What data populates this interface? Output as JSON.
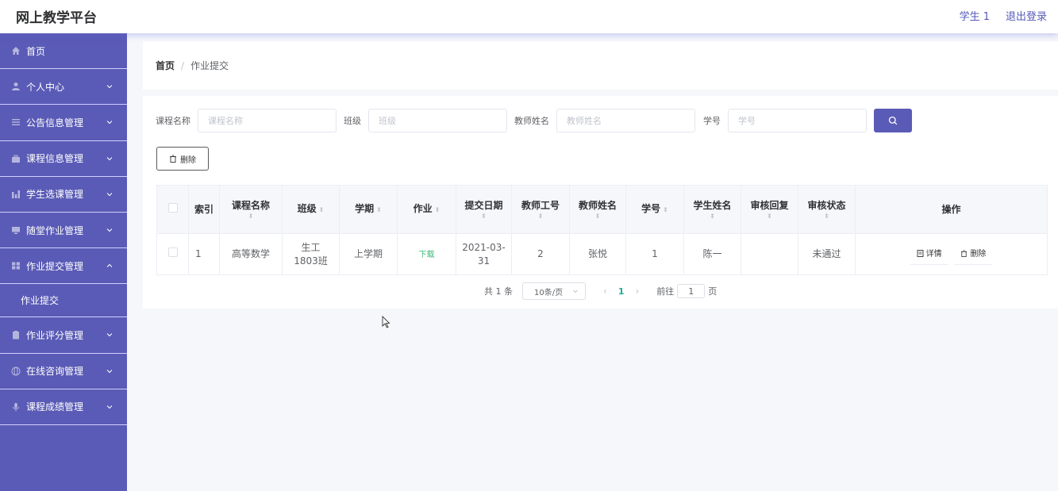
{
  "header": {
    "brand": "网上教学平台",
    "user": "学生 1",
    "logout": "退出登录"
  },
  "sidebar": {
    "items": [
      {
        "label": "首页",
        "icon": "home-icon"
      },
      {
        "label": "个人中心",
        "icon": "user-icon"
      },
      {
        "label": "公告信息管理",
        "icon": "list-icon"
      },
      {
        "label": "课程信息管理",
        "icon": "briefcase-icon"
      },
      {
        "label": "学生选课管理",
        "icon": "chart-icon"
      },
      {
        "label": "随堂作业管理",
        "icon": "monitor-icon"
      },
      {
        "label": "作业提交管理",
        "icon": "grid-icon",
        "expanded": true
      },
      {
        "label": "作业提交",
        "sub": true
      },
      {
        "label": "作业评分管理",
        "icon": "clipboard-icon"
      },
      {
        "label": "在线咨询管理",
        "icon": "globe-icon"
      },
      {
        "label": "课程成绩管理",
        "icon": "microphone-icon"
      }
    ]
  },
  "breadcrumb": {
    "home": "首页",
    "separator": "/",
    "current": "作业提交"
  },
  "search": {
    "course_label": "课程名称",
    "course_placeholder": "课程名称",
    "class_label": "班级",
    "class_placeholder": "班级",
    "teacher_label": "教师姓名",
    "teacher_placeholder": "教师姓名",
    "student_no_label": "学号",
    "student_no_placeholder": "学号"
  },
  "toolbar": {
    "delete_label": "删除"
  },
  "table": {
    "headers": {
      "index": "索引",
      "course": "课程名称",
      "class": "班级",
      "term": "学期",
      "homework": "作业",
      "submit_date": "提交日期",
      "teacher_id": "教师工号",
      "teacher_name": "教师姓名",
      "student_no": "学号",
      "student_name": "学生姓名",
      "review_reply": "审核回复",
      "review_status": "审核状态",
      "actions": "操作"
    },
    "rows": [
      {
        "index": "1",
        "course": "高等数学",
        "class": "生工1803班",
        "term": "上学期",
        "homework": "下载",
        "submit_date": "2021-03-31",
        "teacher_id": "2",
        "teacher_name": "张悦",
        "student_no": "1",
        "student_name": "陈一",
        "review_reply": "",
        "review_status": "未通过",
        "detail_label": "详情",
        "delete_label": "删除"
      }
    ]
  },
  "pagination": {
    "total": "共 1 条",
    "page_size": "10条/页",
    "current_page": "1",
    "goto_prefix": "前往",
    "goto_value": "1",
    "goto_suffix": "页"
  },
  "colors": {
    "sidebar_bg": "#5a5bb6",
    "accent": "#5a5bb6",
    "download_link": "#3cb878",
    "page_active": "#1aad9b"
  }
}
